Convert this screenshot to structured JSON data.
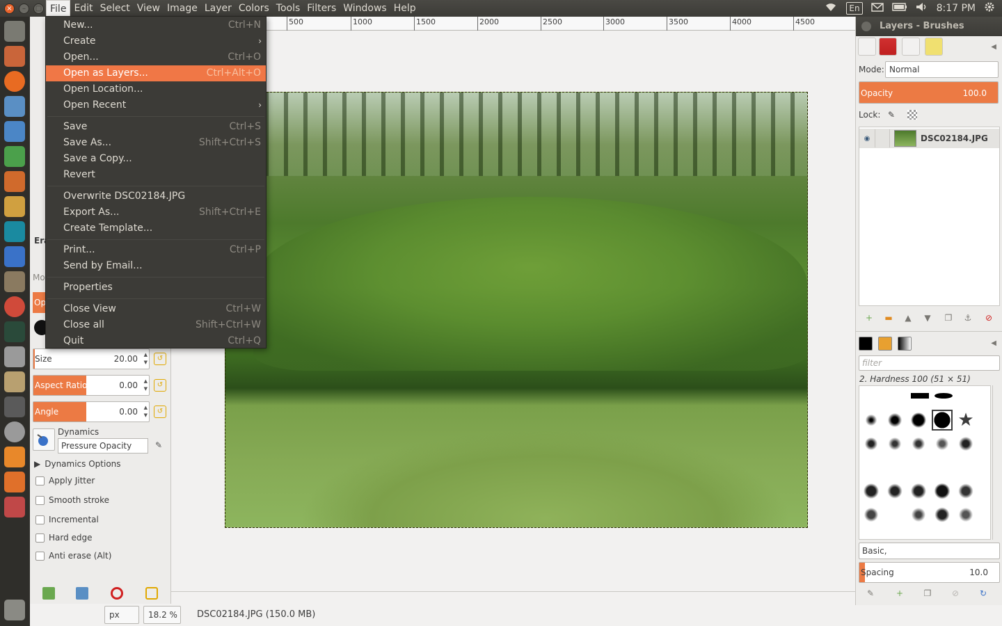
{
  "window": {
    "close_label": "×",
    "min_label": "–",
    "max_label": "□"
  },
  "menubar": {
    "items": [
      "File",
      "Edit",
      "Select",
      "View",
      "Image",
      "Layer",
      "Colors",
      "Tools",
      "Filters",
      "Windows",
      "Help"
    ],
    "active": "File"
  },
  "indicators": {
    "keyboard": "En",
    "time": "8:17 PM",
    "icons": [
      "wifi-icon",
      "keyboard-layout",
      "mail-icon",
      "battery-icon",
      "volume-icon",
      "clock",
      "settings-gear-icon"
    ]
  },
  "file_menu": {
    "items": [
      {
        "label": "New...",
        "accel": "Ctrl+N"
      },
      {
        "label": "Create",
        "submenu": true
      },
      {
        "label": "Open...",
        "accel": "Ctrl+O"
      },
      {
        "label": "Open as Layers...",
        "accel": "Ctrl+Alt+O",
        "highlighted": true
      },
      {
        "label": "Open Location..."
      },
      {
        "label": "Open Recent",
        "submenu": true
      },
      {
        "label": "Save",
        "accel": "Ctrl+S"
      },
      {
        "label": "Save As...",
        "accel": "Shift+Ctrl+S"
      },
      {
        "label": "Save a Copy..."
      },
      {
        "label": "Revert"
      },
      {
        "label": "Overwrite DSC02184.JPG"
      },
      {
        "label": "Export As...",
        "accel": "Shift+Ctrl+E"
      },
      {
        "label": "Create Template..."
      },
      {
        "label": "Print...",
        "accel": "Ctrl+P"
      },
      {
        "label": "Send by Email..."
      },
      {
        "label": "Properties"
      },
      {
        "label": "Close View",
        "accel": "Ctrl+W"
      },
      {
        "label": "Close all",
        "accel": "Shift+Ctrl+W"
      },
      {
        "label": "Quit",
        "accel": "Ctrl+Q"
      }
    ],
    "submenu_arrow": "›"
  },
  "ruler": {
    "ticks": [
      "500",
      "1000",
      "1500",
      "2000",
      "2500",
      "3000",
      "3500",
      "4000",
      "4500"
    ]
  },
  "tool_options": {
    "tool_partial": "Era",
    "mode_partial": "Mo",
    "opacity_partial": "Op",
    "size": {
      "label": "Size",
      "value": "20.00"
    },
    "aspect_ratio": {
      "label": "Aspect Ratio",
      "value": "0.00"
    },
    "angle": {
      "label": "Angle",
      "value": "0.00"
    },
    "dynamics": {
      "label": "Dynamics",
      "value": "Pressure Opacity"
    },
    "dynamics_options": "Dynamics Options",
    "checks": [
      "Apply Jitter",
      "Smooth stroke",
      "Incremental",
      "Hard edge",
      "Anti erase  (Alt)"
    ]
  },
  "statusbar": {
    "unit": "px",
    "zoom": "18.2 %",
    "file_info": "DSC02184.JPG (150.0 MB)"
  },
  "layers_dock": {
    "title": "Layers - Brushes",
    "mode_label": "Mode:",
    "mode_value": "Normal",
    "opacity_label": "Opacity",
    "opacity_value": "100.0",
    "lock_label": "Lock:",
    "layer_name": "DSC02184.JPG"
  },
  "brushes_dock": {
    "filter_placeholder": "filter",
    "brush_name": "2. Hardness 100 (51 × 51)",
    "tag": "Basic,",
    "spacing_label": "Spacing",
    "spacing_value": "10.0"
  },
  "colors": {
    "accent": "#f07746",
    "panel_dark": "#3c3b37",
    "launcher": "#2f2e2a"
  }
}
